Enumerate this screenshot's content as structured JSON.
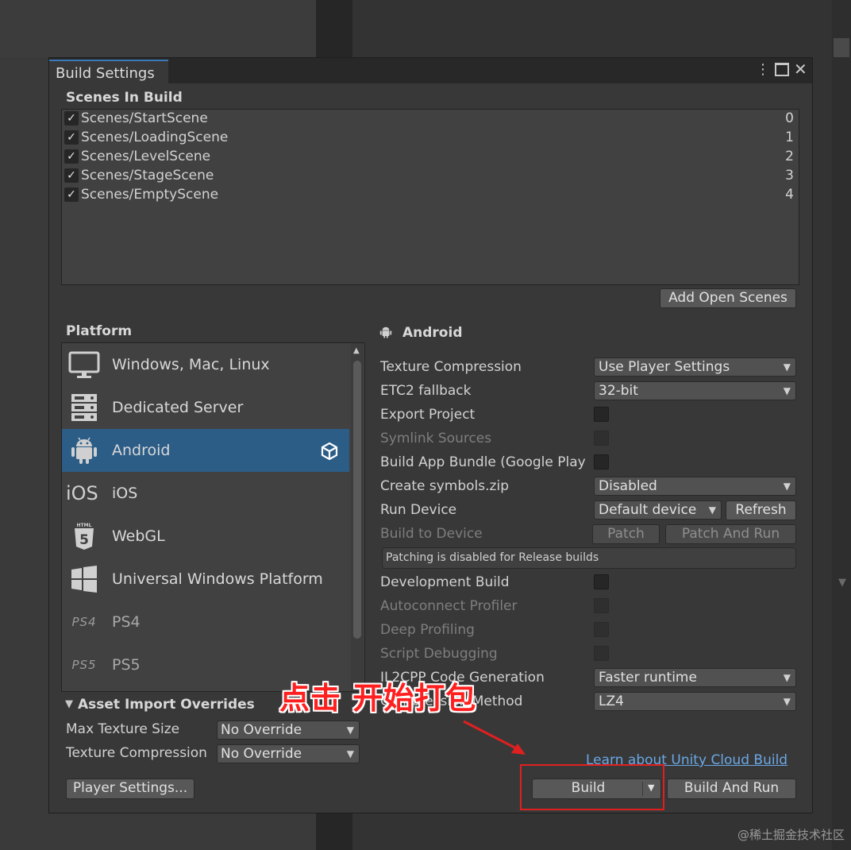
{
  "window": {
    "tab_title": "Build Settings"
  },
  "scenes": {
    "header": "Scenes In Build",
    "items": [
      {
        "name": "Scenes/StartScene",
        "index": "0"
      },
      {
        "name": "Scenes/LoadingScene",
        "index": "1"
      },
      {
        "name": "Scenes/LevelScene",
        "index": "2"
      },
      {
        "name": "Scenes/StageScene",
        "index": "3"
      },
      {
        "name": "Scenes/EmptyScene",
        "index": "4"
      }
    ],
    "add_open_scenes": "Add Open Scenes"
  },
  "platform": {
    "header": "Platform",
    "items": [
      {
        "label": "Windows, Mac, Linux",
        "icon": "monitor-icon"
      },
      {
        "label": "Dedicated Server",
        "icon": "server-icon"
      },
      {
        "label": "Android",
        "icon": "android-icon",
        "selected": true
      },
      {
        "label": "iOS",
        "icon": "ios-icon",
        "icon_text": "iOS"
      },
      {
        "label": "WebGL",
        "icon": "html5-icon"
      },
      {
        "label": "Universal Windows Platform",
        "icon": "windows-icon"
      },
      {
        "label": "PS4",
        "icon": "ps4-icon",
        "icon_text": "PS4"
      },
      {
        "label": "PS5",
        "icon": "ps5-icon",
        "icon_text": "PS5"
      }
    ]
  },
  "asset_overrides": {
    "header": "Asset Import Overrides",
    "max_texture_size_label": "Max Texture Size",
    "max_texture_size_value": "No Override",
    "texture_compression_label": "Texture Compression",
    "texture_compression_value": "No Override"
  },
  "android": {
    "title": "Android",
    "texture_compression": {
      "label": "Texture Compression",
      "value": "Use Player Settings"
    },
    "etc2_fallback": {
      "label": "ETC2 fallback",
      "value": "32-bit"
    },
    "export_project": "Export Project",
    "symlink_sources": "Symlink Sources",
    "build_app_bundle": "Build App Bundle (Google Play",
    "create_symbols": {
      "label": "Create symbols.zip",
      "value": "Disabled"
    },
    "run_device": {
      "label": "Run Device",
      "value": "Default device",
      "refresh": "Refresh"
    },
    "build_to_device": {
      "label": "Build to Device",
      "patch": "Patch",
      "patch_and_run": "Patch And Run"
    },
    "patch_help": "Patching is disabled for Release builds",
    "development_build": "Development Build",
    "autoconnect_profiler": "Autoconnect Profiler",
    "deep_profiling": "Deep Profiling",
    "script_debugging": "Script Debugging",
    "il2cpp": {
      "label": "IL2CPP Code Generation",
      "value": "Faster runtime"
    },
    "compression": {
      "label": "Compression Method",
      "value": "LZ4"
    }
  },
  "footer": {
    "cloud_build_link": "Learn about Unity Cloud Build",
    "player_settings": "Player Settings...",
    "build": "Build",
    "build_and_run": "Build And Run"
  },
  "annotation": {
    "text": "点击 开始打包"
  },
  "watermark": "@稀土掘金技术社区",
  "colors": {
    "accent": "#3a79bb",
    "selected_row": "#2c5d87",
    "annotation": "#e02020",
    "link": "#6aa8e6"
  }
}
